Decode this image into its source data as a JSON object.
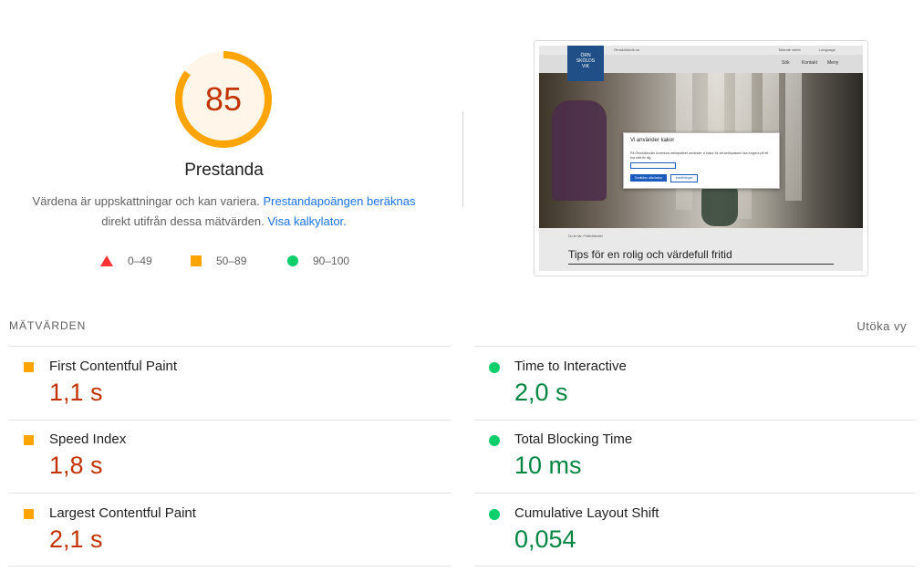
{
  "score": {
    "value": "85",
    "value_fraction": 0.85,
    "title": "Prestanda",
    "ring_color": "#ffa400",
    "text_color": "#c33300",
    "background_color": "#fff6e9"
  },
  "description": {
    "text_before": "Värdena är uppskattningar och kan variera. ",
    "link1": "Prestandapoängen beräknas",
    "text_middle": "direkt utifrån dessa mätvärden. ",
    "link2": "Visa kalkylator."
  },
  "legend": {
    "fail": {
      "label": "0–49",
      "color": "#ff3333",
      "icon": "triangle-icon"
    },
    "average": {
      "label": "50–89",
      "color": "#ffa400",
      "icon": "square-icon"
    },
    "pass": {
      "label": "90–100",
      "color": "#0cce6b",
      "icon": "circle-icon"
    }
  },
  "screenshot": {
    "top_left_text": "Örnsköldsvik.se",
    "top_right_text1": "Talande webb",
    "top_right_text2": "Language",
    "logo_line1": "ÖRN",
    "logo_line2": "SKÖLDS",
    "logo_line3": "VIK",
    "nav_search": "Sök",
    "nav_contact": "Kontakt",
    "nav_menu": "Meny",
    "modal_title": "Vi använder kakor",
    "modal_body": "På Örnsköldsviks kommuns webbplatser använder vi kakor för att webbplatsen ska fungera på ett bra sätt för dig.",
    "modal_accept": "Godkänn alla kakor",
    "modal_settings": "Inställningar",
    "breadcrumb": "Du är här: Fritid/Aktivitet",
    "heading": "Tips för en rolig och värdefull fritid"
  },
  "metrics": {
    "section_title": "MÄTVÄRDEN",
    "expand_label": "Utöka vy",
    "items": [
      {
        "label": "First Contentful Paint",
        "value": "1,1 s",
        "status": "average"
      },
      {
        "label": "Time to Interactive",
        "value": "2,0 s",
        "status": "pass"
      },
      {
        "label": "Speed Index",
        "value": "1,8 s",
        "status": "average"
      },
      {
        "label": "Total Blocking Time",
        "value": "10 ms",
        "status": "pass"
      },
      {
        "label": "Largest Contentful Paint",
        "value": "2,1 s",
        "status": "average"
      },
      {
        "label": "Cumulative Layout Shift",
        "value": "0,054",
        "status": "pass"
      }
    ]
  }
}
